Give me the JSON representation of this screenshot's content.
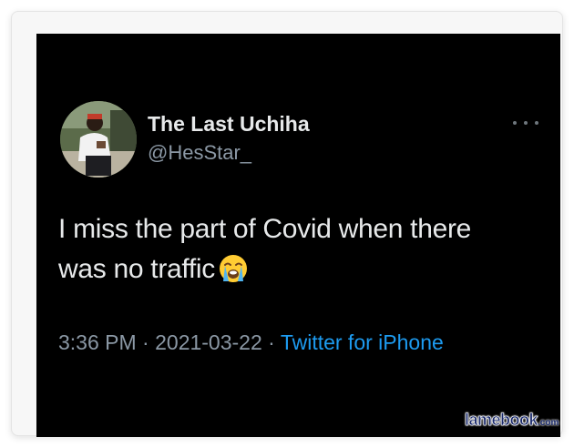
{
  "tweet": {
    "display_name": "The Last Uchiha",
    "handle": "@HesStar_",
    "text_line1": "I miss the part of Covid when there",
    "text_line2": "was no traffic",
    "emoji": "loudly-crying-face",
    "time": "3:36 PM",
    "date": "2021-03-22",
    "separator": "·",
    "source": "Twitter for iPhone"
  },
  "watermark": {
    "main": "lamebook",
    "tld": ".com"
  },
  "colors": {
    "background": "#000000",
    "text": "#e7e9ea",
    "secondary": "#8b98a5",
    "link": "#1d9bf0"
  }
}
